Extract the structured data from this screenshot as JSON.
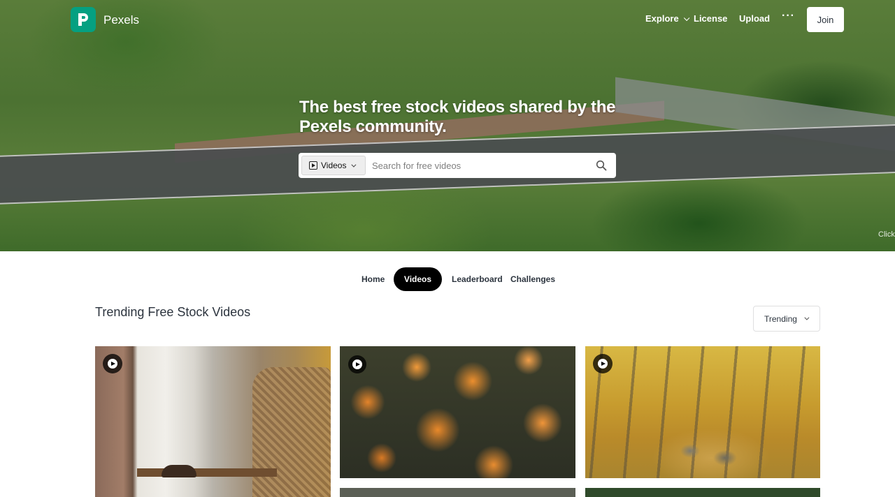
{
  "header": {
    "brand": "Pexels",
    "nav": {
      "explore": "Explore",
      "license": "License",
      "upload": "Upload",
      "more": "···"
    },
    "join": "Join"
  },
  "hero": {
    "headline": "The best free stock videos shared by the Pexels community.",
    "search": {
      "type_label": "Videos",
      "placeholder": "Search for free videos"
    },
    "credit_text": "Click"
  },
  "tabs": [
    "Home",
    "Videos",
    "Leaderboard",
    "Challenges"
  ],
  "active_tab": "Videos",
  "section": {
    "title": "Trending Free Stock Videos",
    "sort": "Trending"
  },
  "colors": {
    "brand_green": "#05a081",
    "active_tab_bg": "#000000",
    "text_dark": "#2c343e"
  },
  "icons": {
    "logo": "pexels-p-icon",
    "search": "magnifier-icon",
    "play": "play-circle-icon",
    "video_type": "play-square-icon"
  }
}
